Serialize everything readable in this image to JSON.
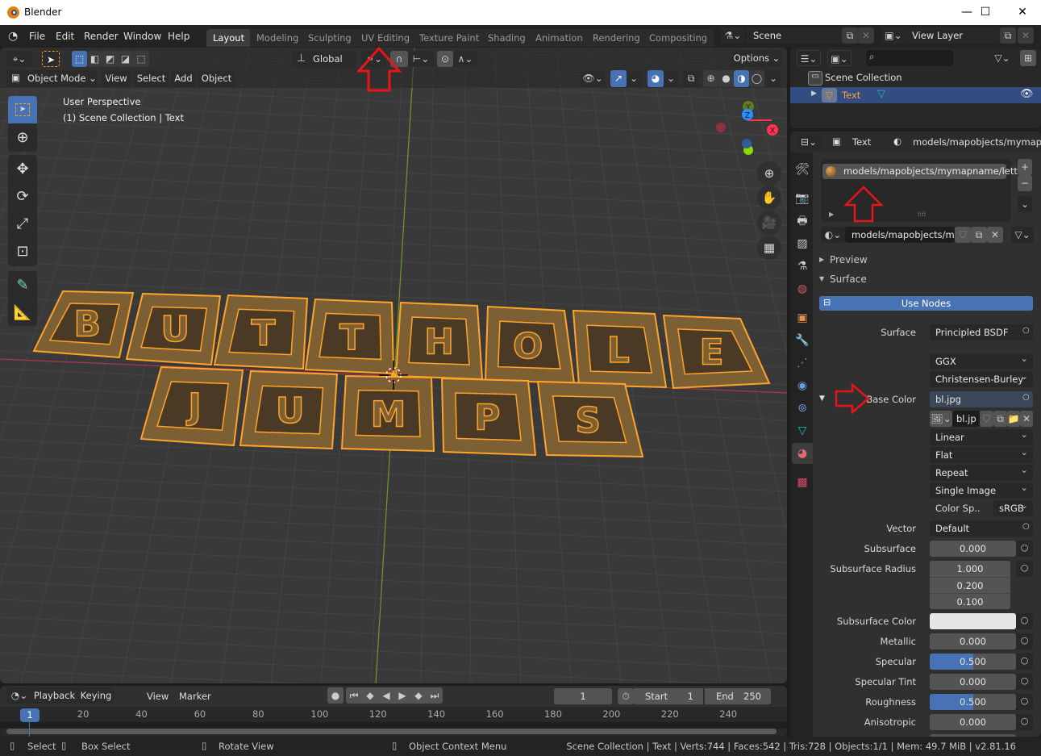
{
  "window": {
    "title": "Blender",
    "controls": [
      "minimize",
      "maximize",
      "close"
    ]
  },
  "menubar": {
    "menus": [
      "File",
      "Edit",
      "Render",
      "Window",
      "Help"
    ],
    "workspaces": [
      "Layout",
      "Modeling",
      "Sculpting",
      "UV Editing",
      "Texture Paint",
      "Shading",
      "Animation",
      "Rendering",
      "Compositing"
    ],
    "active_workspace": "Layout",
    "scene": "Scene",
    "view_layer": "View Layer"
  },
  "viewport": {
    "header": {
      "transform_orientation": "Global",
      "options_label": "Options",
      "mode": "Object Mode",
      "menus": [
        "View",
        "Select",
        "Add",
        "Object"
      ]
    },
    "overlay_text": {
      "line1": "User Perspective",
      "line2": "(1) Scene Collection | Text"
    },
    "gizmo_axes": [
      "X",
      "Y",
      "Z"
    ],
    "scene_text_object": {
      "line1": "BUTTHOLE",
      "line2": "JUMPS"
    },
    "colors": {
      "selection_outline": "#ffa32a",
      "object_fill": "#7d5f34",
      "x_axis": "#ff3352",
      "y_axis": "#8bdc00",
      "z_axis": "#2890ff"
    }
  },
  "outliner": {
    "search_placeholder": "",
    "scene_collection": "Scene Collection",
    "items": [
      {
        "name": "Text",
        "selected": true,
        "visible": true
      }
    ]
  },
  "properties": {
    "breadcrumb": {
      "object": "Text",
      "material": "models/mapobjects/mymapname/letters"
    },
    "material_slot": "models/mapobjects/mymapname/lett..",
    "material_name": "models/mapobjects/my..",
    "panels": {
      "preview": "Preview",
      "surface": "Surface"
    },
    "use_nodes_label": "Use Nodes",
    "surface_label": "Surface",
    "surface_shader": "Principled BSDF",
    "distribution": "GGX",
    "subsurface_method": "Christensen-Burley",
    "base_color_label": "Base Color",
    "base_color_value": "bl.jpg",
    "image_name": "bl.jp",
    "interpolation": "Linear",
    "projection": "Flat",
    "extension": "Repeat",
    "source": "Single Image",
    "color_space_label": "Color Sp..",
    "color_space": "sRGB",
    "vector_label": "Vector",
    "vector_value": "Default",
    "params": [
      {
        "label": "Subsurface",
        "value": "0.000",
        "fraction": 0
      },
      {
        "label": "Metallic",
        "value": "0.000",
        "fraction": 0
      },
      {
        "label": "Specular",
        "value": "0.500",
        "fraction": 0.5
      },
      {
        "label": "Specular Tint",
        "value": "0.000",
        "fraction": 0
      },
      {
        "label": "Roughness",
        "value": "0.500",
        "fraction": 0.5
      },
      {
        "label": "Anisotropic",
        "value": "0.000",
        "fraction": 0
      }
    ],
    "subsurface_radius_label": "Subsurface Radius",
    "subsurface_radius": [
      "1.000",
      "0.200",
      "0.100"
    ],
    "subsurface_color_label": "Subsurface Color",
    "subsurface_color": "#e6e6e6"
  },
  "timeline": {
    "menus": [
      "Playback",
      "Keying",
      "View",
      "Marker"
    ],
    "current_frame": "1",
    "start_label": "Start",
    "start": "1",
    "end_label": "End",
    "end": "250",
    "ruler": [
      "20",
      "40",
      "60",
      "80",
      "100",
      "120",
      "140",
      "160",
      "180",
      "200",
      "220",
      "240"
    ],
    "playhead": "1"
  },
  "statusbar": {
    "hints": [
      "Select",
      "Box Select",
      "Rotate View",
      "Object Context Menu"
    ],
    "info": "Scene Collection | Text | Verts:744 | Faces:542 | Tris:728 | Objects:1/1 | Mem: 49.7 MiB | v2.81.16"
  },
  "annotations": {
    "arrow_color": "#e8141b"
  }
}
